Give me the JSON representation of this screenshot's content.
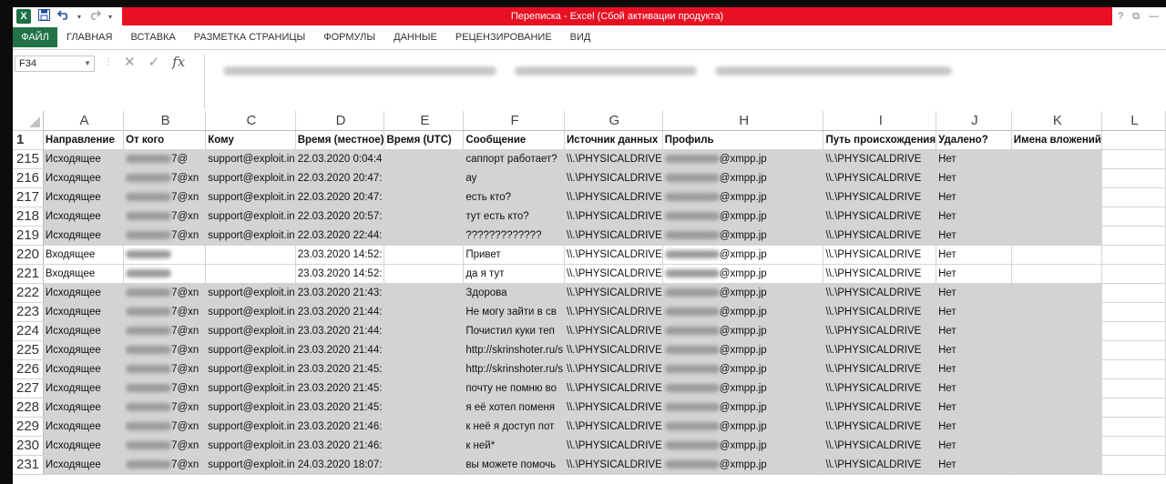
{
  "titlebar": {
    "title": "Переписка -  Excel (Сбой активации продукта)",
    "app_icon": "X",
    "help": "?",
    "restore": "⧉",
    "minimize": "—"
  },
  "ribbon": {
    "tabs": [
      "ФАЙЛ",
      "ГЛАВНАЯ",
      "ВСТАВКА",
      "РАЗМЕТКА СТРАНИЦЫ",
      "ФОРМУЛЫ",
      "ДАННЫЕ",
      "РЕЦЕНЗИРОВАНИЕ",
      "ВИД"
    ]
  },
  "formula_bar": {
    "name_box": "F34",
    "cancel": "✕",
    "enter": "✓",
    "fx": "fx"
  },
  "grid": {
    "columns": [
      "A",
      "B",
      "C",
      "D",
      "E",
      "F",
      "G",
      "H",
      "I",
      "J",
      "K",
      "L"
    ],
    "header_row": {
      "num": "1",
      "cells": [
        "Направление",
        "От кого",
        "Кому",
        "Время (местное)",
        "Время (UTC)",
        "Сообщение",
        "Источник данных",
        "Профиль",
        "Путь происхождения",
        "Удалено?",
        "Имена вложений",
        ""
      ]
    },
    "rows": [
      {
        "num": "215",
        "dir": "Исходящее",
        "from": "7@",
        "to": "support@exploit.in",
        "time": "22.03.2020 0:04:4",
        "msg": "саппорт работает?",
        "src": "\\\\.\\PHYSICALDRIVE",
        "prof": "@xmpp.jp",
        "path": "\\\\.\\PHYSICALDRIVE",
        "del": "Нет",
        "gray": true
      },
      {
        "num": "216",
        "dir": "Исходящее",
        "from": "7@xn",
        "to": "support@exploit.in",
        "time": "22.03.2020 20:47:",
        "msg": "ау",
        "src": "\\\\.\\PHYSICALDRIVE",
        "prof": "@xmpp.jp",
        "path": "\\\\.\\PHYSICALDRIVE",
        "del": "Нет",
        "gray": true
      },
      {
        "num": "217",
        "dir": "Исходящее",
        "from": "7@xn",
        "to": "support@exploit.in",
        "time": "22.03.2020 20:47:",
        "msg": "есть кто?",
        "src": "\\\\.\\PHYSICALDRIVE",
        "prof": "@xmpp.jp",
        "path": "\\\\.\\PHYSICALDRIVE",
        "del": "Нет",
        "gray": true
      },
      {
        "num": "218",
        "dir": "Исходящее",
        "from": "7@xn",
        "to": "support@exploit.in",
        "time": "22.03.2020 20:57:",
        "msg": "тут есть кто?",
        "src": "\\\\.\\PHYSICALDRIVE",
        "prof": "@xmpp.jp",
        "path": "\\\\.\\PHYSICALDRIVE",
        "del": "Нет",
        "gray": true
      },
      {
        "num": "219",
        "dir": "Исходящее",
        "from": "7@xn",
        "to": "support@exploit.in",
        "time": "22.03.2020 22:44:",
        "msg": "?????????????",
        "src": "\\\\.\\PHYSICALDRIVE",
        "prof": "@xmpp.jp",
        "path": "\\\\.\\PHYSICALDRIVE",
        "del": "Нет",
        "gray": true
      },
      {
        "num": "220",
        "dir": "Входящее",
        "from": "",
        "to": "",
        "time": "23.03.2020 14:52:",
        "msg": "Привет",
        "src": "\\\\.\\PHYSICALDRIVE",
        "prof": "@xmpp.jp",
        "path": "\\\\.\\PHYSICALDRIVE",
        "del": "Нет",
        "gray": false
      },
      {
        "num": "221",
        "dir": "Входящее",
        "from": "",
        "to": "",
        "time": "23.03.2020 14:52:",
        "msg": "да я тут",
        "src": "\\\\.\\PHYSICALDRIVE",
        "prof": "@xmpp.jp",
        "path": "\\\\.\\PHYSICALDRIVE",
        "del": "Нет",
        "gray": false
      },
      {
        "num": "222",
        "dir": "Исходящее",
        "from": "7@xn",
        "to": "support@exploit.in",
        "time": "23.03.2020 21:43:",
        "msg": "Здорова",
        "src": "\\\\.\\PHYSICALDRIVE",
        "prof": "@xmpp.jp",
        "path": "\\\\.\\PHYSICALDRIVE",
        "del": "Нет",
        "gray": true
      },
      {
        "num": "223",
        "dir": "Исходящее",
        "from": "7@xn",
        "to": "support@exploit.in",
        "time": "23.03.2020 21:44:",
        "msg": "Не могу зайти в св",
        "src": "\\\\.\\PHYSICALDRIVE",
        "prof": "@xmpp.jp",
        "path": "\\\\.\\PHYSICALDRIVE",
        "del": "Нет",
        "gray": true
      },
      {
        "num": "224",
        "dir": "Исходящее",
        "from": "7@xn",
        "to": "support@exploit.in",
        "time": "23.03.2020 21:44:",
        "msg": "Почистил куки теп",
        "src": "\\\\.\\PHYSICALDRIVE",
        "prof": "@xmpp.jp",
        "path": "\\\\.\\PHYSICALDRIVE",
        "del": "Нет",
        "gray": true
      },
      {
        "num": "225",
        "dir": "Исходящее",
        "from": "7@xn",
        "to": "support@exploit.in",
        "time": "23.03.2020 21:44:",
        "msg": "http://skrinshoter.ru/s",
        "src": "\\\\.\\PHYSICALDRIVE",
        "prof": "@xmpp.jp",
        "path": "\\\\.\\PHYSICALDRIVE",
        "del": "Нет",
        "gray": true
      },
      {
        "num": "226",
        "dir": "Исходящее",
        "from": "7@xn",
        "to": "support@exploit.in",
        "time": "23.03.2020 21:45:",
        "msg": "http://skrinshoter.ru/s",
        "src": "\\\\.\\PHYSICALDRIVE",
        "prof": "@xmpp.jp",
        "path": "\\\\.\\PHYSICALDRIVE",
        "del": "Нет",
        "gray": true
      },
      {
        "num": "227",
        "dir": "Исходящее",
        "from": "7@xn",
        "to": "support@exploit.in",
        "time": "23.03.2020 21:45:",
        "msg": "почту не помню во",
        "src": "\\\\.\\PHYSICALDRIVE",
        "prof": "@xmpp.jp",
        "path": "\\\\.\\PHYSICALDRIVE",
        "del": "Нет",
        "gray": true
      },
      {
        "num": "228",
        "dir": "Исходящее",
        "from": "7@xn",
        "to": "support@exploit.in",
        "time": "23.03.2020 21:45:",
        "msg": "я её хотел поменя",
        "src": "\\\\.\\PHYSICALDRIVE",
        "prof": "@xmpp.jp",
        "path": "\\\\.\\PHYSICALDRIVE",
        "del": "Нет",
        "gray": true
      },
      {
        "num": "229",
        "dir": "Исходящее",
        "from": "7@xn",
        "to": "support@exploit.in",
        "time": "23.03.2020 21:46:",
        "msg": "к неё я доступ пот",
        "src": "\\\\.\\PHYSICALDRIVE",
        "prof": "@xmpp.jp",
        "path": "\\\\.\\PHYSICALDRIVE",
        "del": "Нет",
        "gray": true
      },
      {
        "num": "230",
        "dir": "Исходящее",
        "from": "7@xn",
        "to": "support@exploit.in",
        "time": "23.03.2020 21:46:",
        "msg": "к ней*",
        "src": "\\\\.\\PHYSICALDRIVE",
        "prof": "@xmpp.jp",
        "path": "\\\\.\\PHYSICALDRIVE",
        "del": "Нет",
        "gray": true
      },
      {
        "num": "231",
        "dir": "Исходящее",
        "from": "7@xn",
        "to": "support@exploit.in",
        "time": "24.03.2020 18:07:",
        "msg": "вы можете помочь",
        "src": "\\\\.\\PHYSICALDRIVE",
        "prof": "@xmpp.jp",
        "path": "\\\\.\\PHYSICALDRIVE",
        "del": "Нет",
        "gray": true
      }
    ]
  }
}
